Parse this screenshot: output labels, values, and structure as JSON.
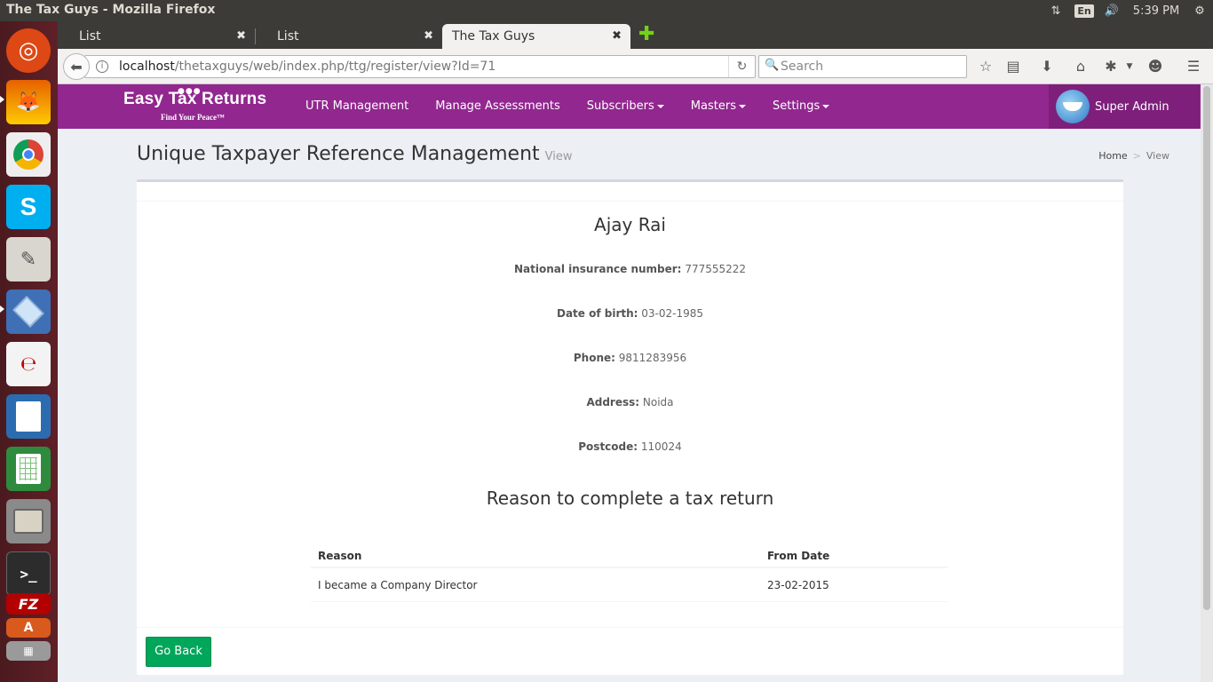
{
  "os": {
    "window_title": "The Tax Guys - Mozilla Firefox",
    "language": "En",
    "time": "5:39 PM"
  },
  "browser": {
    "tabs": [
      {
        "label": "List"
      },
      {
        "label": "List"
      },
      {
        "label": "The Tax Guys"
      }
    ],
    "url_host": "localhost",
    "url_path": "/thetaxguys/web/index.php/ttg/register/view?Id=71",
    "search_placeholder": "Search"
  },
  "site": {
    "logo_text": "Easy Tax Returns",
    "logo_tagline": "Find Your Peace™",
    "menu": [
      {
        "label": "UTR Management"
      },
      {
        "label": "Manage Assessments"
      },
      {
        "label": "Subscribers"
      },
      {
        "label": "Masters"
      },
      {
        "label": "Settings"
      }
    ],
    "user_name": "Super Admin",
    "brand_color": "#92278f"
  },
  "page": {
    "title": "Unique Taxpayer Reference Management",
    "subtitle": "View",
    "breadcrumb": [
      "Home",
      "View"
    ]
  },
  "profile": {
    "name": "Ajay Rai",
    "fields": [
      {
        "label": "National insurance number:",
        "value": "777555222"
      },
      {
        "label": "Date of birth:",
        "value": "03-02-1985"
      },
      {
        "label": "Phone:",
        "value": "9811283956"
      },
      {
        "label": "Address:",
        "value": "Noida"
      },
      {
        "label": "Postcode:",
        "value": "110024"
      }
    ]
  },
  "reasons": {
    "title": "Reason to complete a tax return",
    "headers": [
      "Reason",
      "From Date"
    ],
    "rows": [
      {
        "reason": "I became a Company Director",
        "from_date": "23-02-2015"
      }
    ]
  },
  "actions": {
    "go_back": "Go Back",
    "go_back_color": "#00a65a"
  }
}
